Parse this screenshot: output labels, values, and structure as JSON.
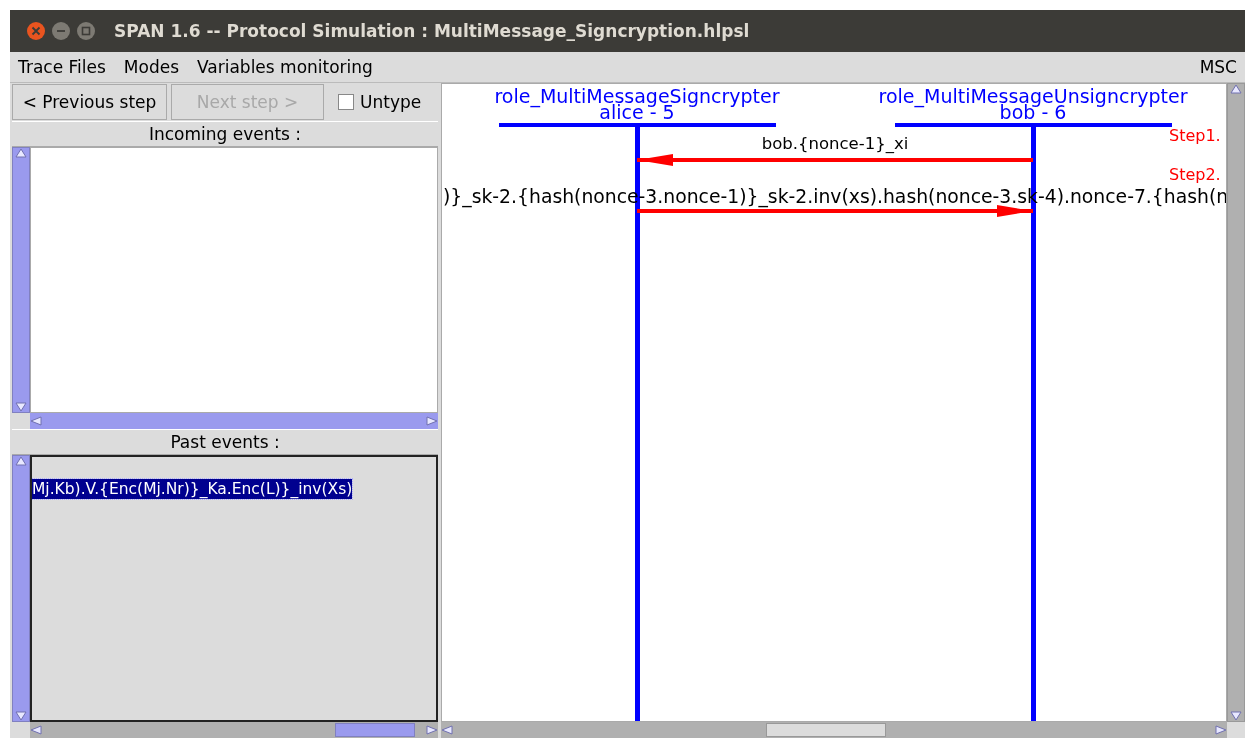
{
  "window": {
    "title": "SPAN 1.6 -- Protocol Simulation : MultiMessage_Signcryption.hlpsl"
  },
  "menu": [
    {
      "label": "Trace Files"
    },
    {
      "label": "Modes"
    },
    {
      "label": "Variables monitoring"
    }
  ],
  "menu_right": {
    "label": "MSC"
  },
  "toolbar": {
    "buttons": [
      {
        "label": "< Previous step",
        "disabled": false
      },
      {
        "label": "Next step >",
        "disabled": true
      }
    ],
    "checkbox": {
      "label": "Untype",
      "checked": false
    }
  },
  "incoming": {
    "title": "Incoming events :"
  },
  "past": {
    "title": "Past events :",
    "items": [
      {
        "text": "Mj.Kb).V.{Enc(Mj.Nr)}_Ka.Enc(L)}_inv(Xs)",
        "selected": true
      }
    ]
  },
  "msc": {
    "roles": [
      {
        "name": "role_MultiMessageSigncrypter",
        "instance": "alice - 5"
      },
      {
        "name": "role_MultiMessageUnsigncrypter",
        "instance": "bob - 6"
      }
    ],
    "messages": [
      {
        "label": "bob.{nonce-1}_xi",
        "leftward": true,
        "step": "Step1."
      },
      {
        "label": ")}_sk-2.{hash(nonce-3.nonce-1)}_sk-2.inv(xs).hash(nonce-3.sk-4).nonce-7.{hash(n",
        "leftward": false,
        "step": "Step2."
      }
    ]
  }
}
